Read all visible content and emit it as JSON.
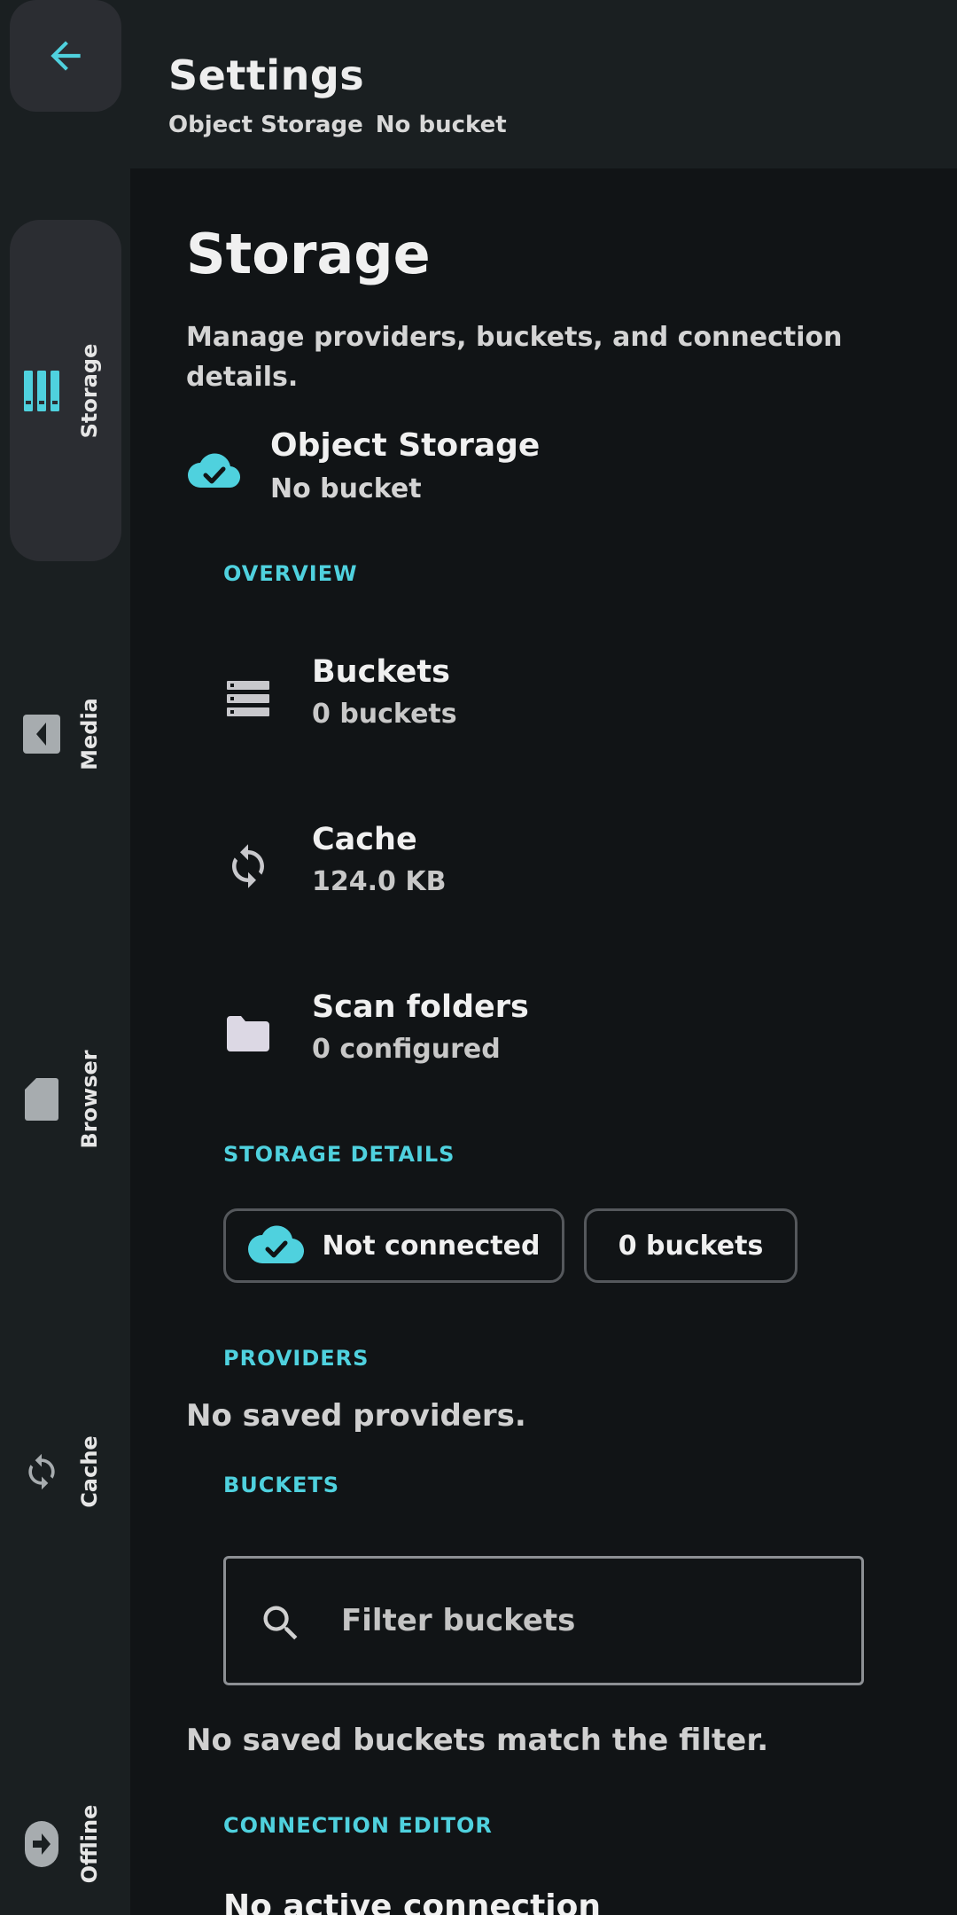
{
  "header": {
    "title": "Settings",
    "subtitle_provider": "Object Storage",
    "subtitle_bucket": "No bucket"
  },
  "rail": {
    "items": [
      {
        "label": "Storage",
        "icon": "storage-bars-icon",
        "active": true
      },
      {
        "label": "Media",
        "icon": "media-icon",
        "active": false
      },
      {
        "label": "Browser",
        "icon": "sd-card-icon",
        "active": false
      },
      {
        "label": "Cache",
        "icon": "sync-icon",
        "active": false
      },
      {
        "label": "Offline",
        "icon": "offline-icon",
        "active": false
      }
    ]
  },
  "main": {
    "title": "Storage",
    "description": "Manage providers, buckets, and connection details.",
    "summary": {
      "title": "Object Storage",
      "subtitle": "No bucket",
      "icon": "cloud-check-icon"
    },
    "sections": {
      "overview": "OVERVIEW",
      "storage_details": "STORAGE DETAILS",
      "providers": "PROVIDERS",
      "buckets": "BUCKETS",
      "connection_editor": "CONNECTION EDITOR"
    },
    "overview_items": [
      {
        "title": "Buckets",
        "subtitle": "0 buckets",
        "icon": "list-icon"
      },
      {
        "title": "Cache",
        "subtitle": "124.0 KB",
        "icon": "sync-icon"
      },
      {
        "title": "Scan folders",
        "subtitle": "0 configured",
        "icon": "folder-icon"
      }
    ],
    "chips": {
      "status": "Not connected",
      "count": "0 buckets"
    },
    "providers_empty": "No saved providers.",
    "filter": {
      "placeholder": "Filter buckets",
      "value": ""
    },
    "buckets_empty": "No saved buckets match the filter.",
    "connection_heading": "No active connection"
  },
  "colors": {
    "accent": "#4fd1de",
    "background": "#111416",
    "rail": "#1a1f21",
    "active_pill": "#2b2d32"
  }
}
